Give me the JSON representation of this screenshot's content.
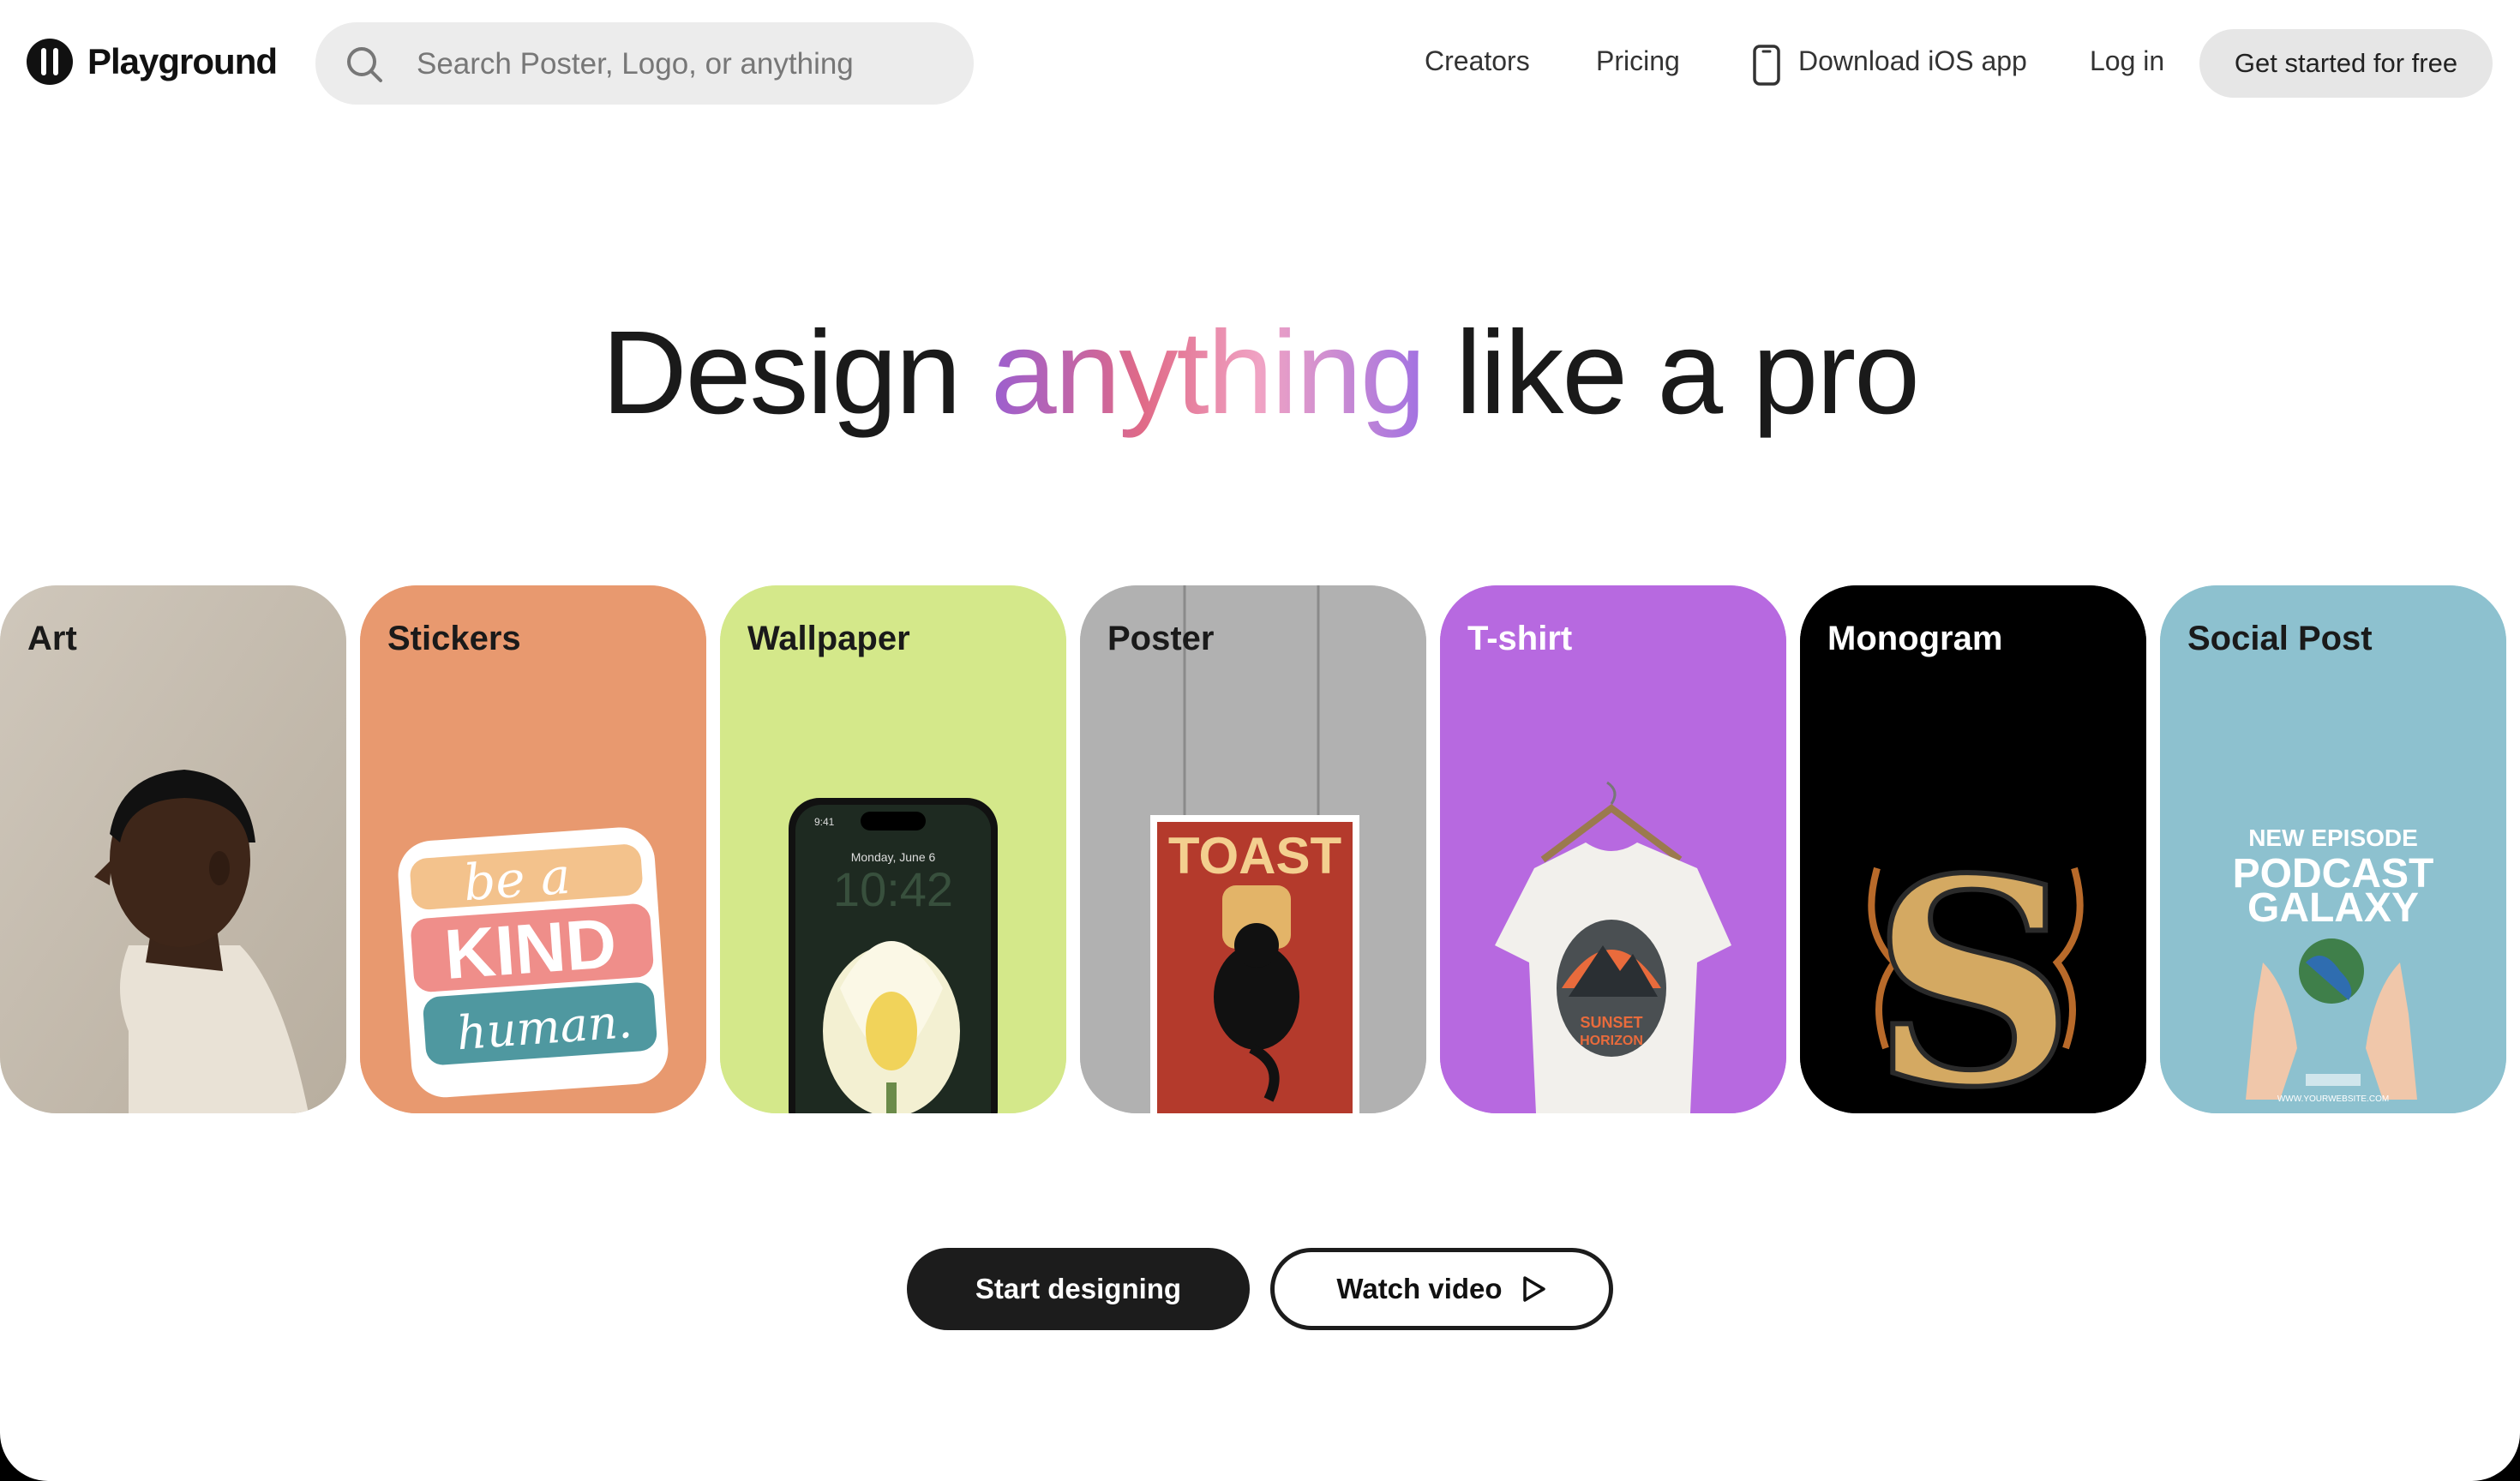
{
  "header": {
    "logo_text": "Playground",
    "search_placeholder": "Search Poster, Logo, or anything",
    "nav": {
      "creators": "Creators",
      "pricing": "Pricing",
      "download_ios": "Download iOS app",
      "login": "Log in",
      "get_started": "Get started for free"
    }
  },
  "hero": {
    "before": "Design ",
    "highlight": "anything",
    "after": " like a pro"
  },
  "cards": [
    {
      "label": "Art",
      "bg": "#d6cfc4",
      "label_color": "#1a1a1a"
    },
    {
      "label": "Stickers",
      "bg": "#e8996f",
      "label_color": "#1a1a1a",
      "art_lines": [
        "be a",
        "KIND",
        "human."
      ]
    },
    {
      "label": "Wallpaper",
      "bg": "#d4e88a",
      "label_color": "#1a1a1a",
      "art_lines": [
        "9:41",
        "Monday, June 6",
        "10:42"
      ]
    },
    {
      "label": "Poster",
      "bg": "#b1b1b1",
      "label_color": "#1a1a1a",
      "art_lines": [
        "TOAST"
      ]
    },
    {
      "label": "T-shirt",
      "bg": "#b769e0",
      "label_color": "#ffffff",
      "art_lines": [
        "SUNSET",
        "HORIZON"
      ]
    },
    {
      "label": "Monogram",
      "bg": "#000000",
      "label_color": "#ffffff",
      "art_lines": [
        "S"
      ]
    },
    {
      "label": "Social Post",
      "bg": "#8dc1cf",
      "label_color": "#1a1a1a",
      "art_lines": [
        "NEW EPISODE",
        "PODCAST",
        "GALAXY",
        "WWW.YOURWEBSITE.COM"
      ]
    }
  ],
  "actions": {
    "start": "Start designing",
    "watch": "Watch video"
  },
  "colors": {
    "accent_gradient": [
      "#9b5fd0",
      "#e06a87",
      "#f0a3c4",
      "#a171e2"
    ],
    "primary_button": "#1c1c1c"
  }
}
